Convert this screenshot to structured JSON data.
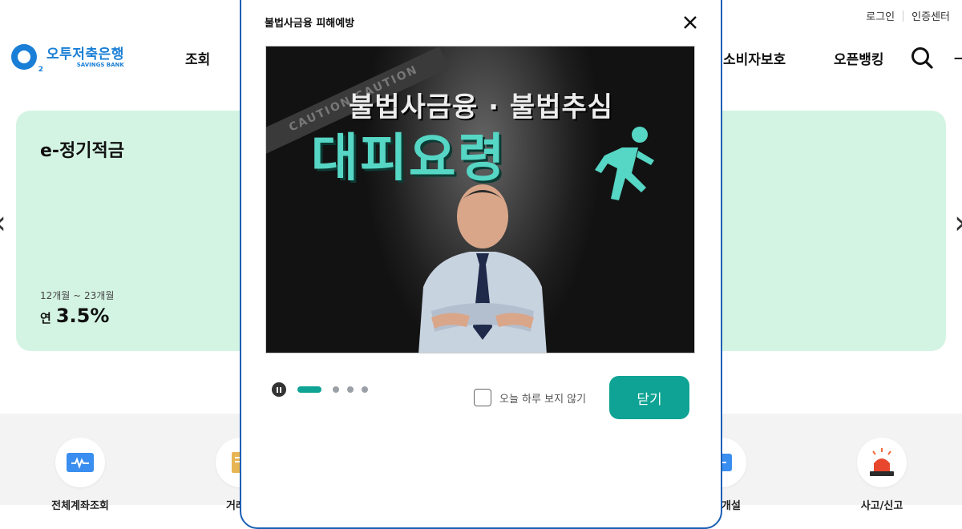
{
  "header": {
    "login_label": "로그인",
    "cert_label": "인증센터",
    "logo_text": "오투저축은행",
    "logo_sub": "SAVINGS BANK",
    "logo_mark_sub": "2",
    "nav": [
      "조회",
      "소비자보호",
      "오픈뱅킹"
    ],
    "menu_edge": "ㅡ"
  },
  "banner": {
    "title": "e-정기적금",
    "period": "12개월 ~ 23개월",
    "rate_prefix": "연",
    "rate": "3.5%"
  },
  "carousel": {
    "prev_label": "‹",
    "next_label": "›"
  },
  "quick_menu": [
    {
      "label": "전체계좌조회",
      "icon": "chart-card-icon"
    },
    {
      "label": "거래내",
      "icon": "folder-icon"
    },
    {
      "label": "계좌개설",
      "icon": "account-icon"
    },
    {
      "label": "사고/신고",
      "icon": "siren-icon"
    }
  ],
  "modal": {
    "title": "불법사금융 피해예방",
    "visual": {
      "caution_text": "CAUTION   CAUTION",
      "headline": "불법사금융 · 불법추심",
      "subheadline": "대피요령"
    },
    "no_show_label": "오늘 하루 보지 않기",
    "close_label": "닫기",
    "slide_count": 4,
    "active_slide": 1
  },
  "colors": {
    "brand": "#1a7fd6",
    "accent": "#0ea394",
    "banner_bg": "#d4f4e3",
    "modal_border": "#1a5fb4"
  }
}
